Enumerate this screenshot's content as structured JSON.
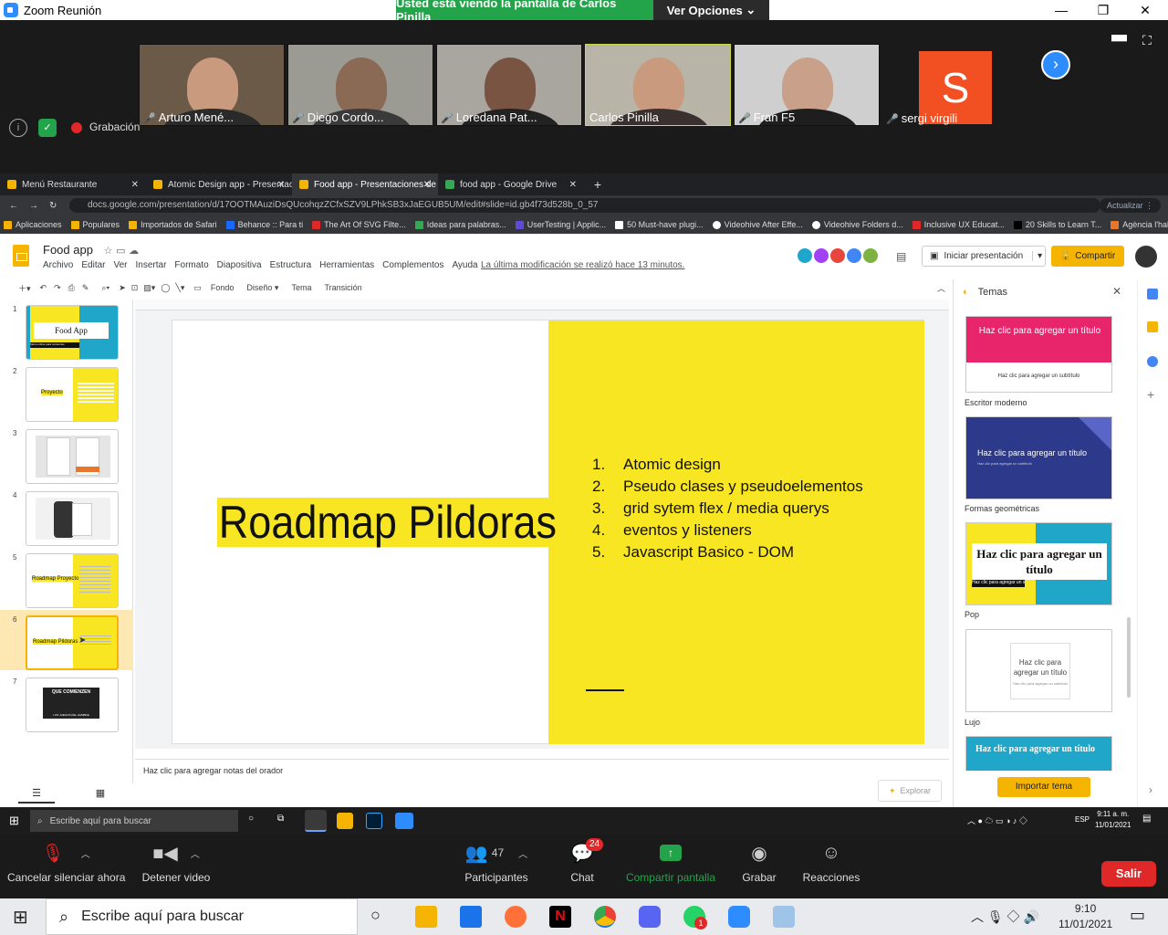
{
  "zoom": {
    "window_title": "Zoom Reunión",
    "share_message": "Usted está viendo la pantalla de Carlos Pinilla",
    "view_options": "Ver Opciones",
    "recording": "Grabación",
    "participants_tiles": [
      {
        "name": "Arturo Mené...",
        "muted": true
      },
      {
        "name": "Diego Cordo...",
        "muted": true
      },
      {
        "name": "Loredana Pat...",
        "muted": true
      },
      {
        "name": "Carlos Pinilla",
        "muted": false
      },
      {
        "name": "Fran F5",
        "muted": true
      },
      {
        "name": "sergi virgili",
        "muted": true
      }
    ],
    "avatar_letter": "S",
    "controls": {
      "unmute": "Cancelar silenciar ahora",
      "video": "Detener video",
      "participants": "Participantes",
      "participants_count": "47",
      "chat": "Chat",
      "chat_badge": "24",
      "share": "Compartir pantalla",
      "record": "Grabar",
      "reactions": "Reacciones",
      "leave": "Salir"
    }
  },
  "browser": {
    "tabs": [
      {
        "title": "Menú Restaurante",
        "active": false
      },
      {
        "title": "Atomic Design app - Presentacio",
        "active": false
      },
      {
        "title": "Food app - Presentaciones de Go",
        "active": true
      },
      {
        "title": "food app - Google Drive",
        "active": false
      }
    ],
    "url": "docs.google.com/presentation/d/17OOTMAuziDsQUcohqzZCfxSZV9LPhkSB3xJaEGUB5UM/edit#slide=id.gb4f73d528b_0_57",
    "update_label": "Actualizar",
    "bookmarks": [
      "Aplicaciones",
      "Populares",
      "Importados de Safari",
      "Behance :: Para ti",
      "The Art Of SVG Filte...",
      "Ideas para palabras...",
      "UserTesting | Applic...",
      "50 Must-have plugi...",
      "Videohive After Effe...",
      "Videohive Folders d...",
      "Inclusive UX Educat...",
      "20 Skills to Learn T...",
      "Agència l'habitatge..."
    ]
  },
  "slides": {
    "doc_title": "Food app",
    "menus": [
      "Archivo",
      "Editar",
      "Ver",
      "Insertar",
      "Formato",
      "Diapositiva",
      "Estructura",
      "Herramientas",
      "Complementos",
      "Ayuda"
    ],
    "last_modified": "La última modificación se realizó hace 13 minutos.",
    "present_button": "Iniciar presentación",
    "share_button": "Compartir",
    "toolbar": {
      "background": "Fondo",
      "layout": "Diseño",
      "theme": "Tema",
      "transition": "Transición"
    },
    "thumbnails": [
      {
        "num": "1",
        "title": "Food App",
        "subtitle": "Menú online para comercios"
      },
      {
        "num": "2",
        "title": "Proyecto"
      },
      {
        "num": "3"
      },
      {
        "num": "4"
      },
      {
        "num": "5",
        "title": "Roadmap Proyecto"
      },
      {
        "num": "6",
        "title": "Roadmap Pildoras"
      },
      {
        "num": "7",
        "title": "QUE COMIENZEN",
        "subtitle": "LOS JUEGOS DEL HAMBRE"
      }
    ],
    "current_slide": {
      "title": "Roadmap Pildoras",
      "items": [
        {
          "n": "1.",
          "text": "Atomic design"
        },
        {
          "n": "2.",
          "text": "Pseudo clases y pseudoelementos"
        },
        {
          "n": "3.",
          "text": "grid sytem flex / media querys"
        },
        {
          "n": "4.",
          "text": "eventos y listeners"
        },
        {
          "n": "5.",
          "text": "Javascript Basico - DOM"
        }
      ]
    },
    "notes_placeholder": "Haz clic para agregar notas del orador",
    "explore": "Explorar",
    "themes_panel": {
      "title": "Temas",
      "cards": [
        {
          "label": "Escritor moderno",
          "title": "Haz clic para agregar un título",
          "subtitle": "Haz clic para agregar un subtítulo"
        },
        {
          "label": "Formas geométricas",
          "title": "Haz clic para agregar un título",
          "subtitle": "Haz clic para agregar un subtítulo"
        },
        {
          "label": "Pop",
          "title": "Haz clic para agregar un título",
          "subtitle": "Haz clic para agregar un subtítulo"
        },
        {
          "label": "Lujo",
          "title": "Haz clic para agregar un título",
          "subtitle": "Haz clic para agregar un subtítulo"
        },
        {
          "label": "",
          "title": "Haz clic para agregar un título",
          "subtitle": ""
        }
      ],
      "import": "Importar tema"
    }
  },
  "taskbar_inner": {
    "search": "Escribe aquí para buscar",
    "time": "9:11 a. m.",
    "date": "11/01/2021",
    "lang": "ESP"
  },
  "taskbar_outer": {
    "search": "Escribe aquí para buscar",
    "time": "9:10",
    "date": "11/01/2021",
    "whatsapp_badge": "1"
  },
  "colors": {
    "slide_yellow": "#f9e623",
    "zoom_green": "#23a44a",
    "leave_red": "#e02828",
    "share_orange": "#f4b400"
  }
}
